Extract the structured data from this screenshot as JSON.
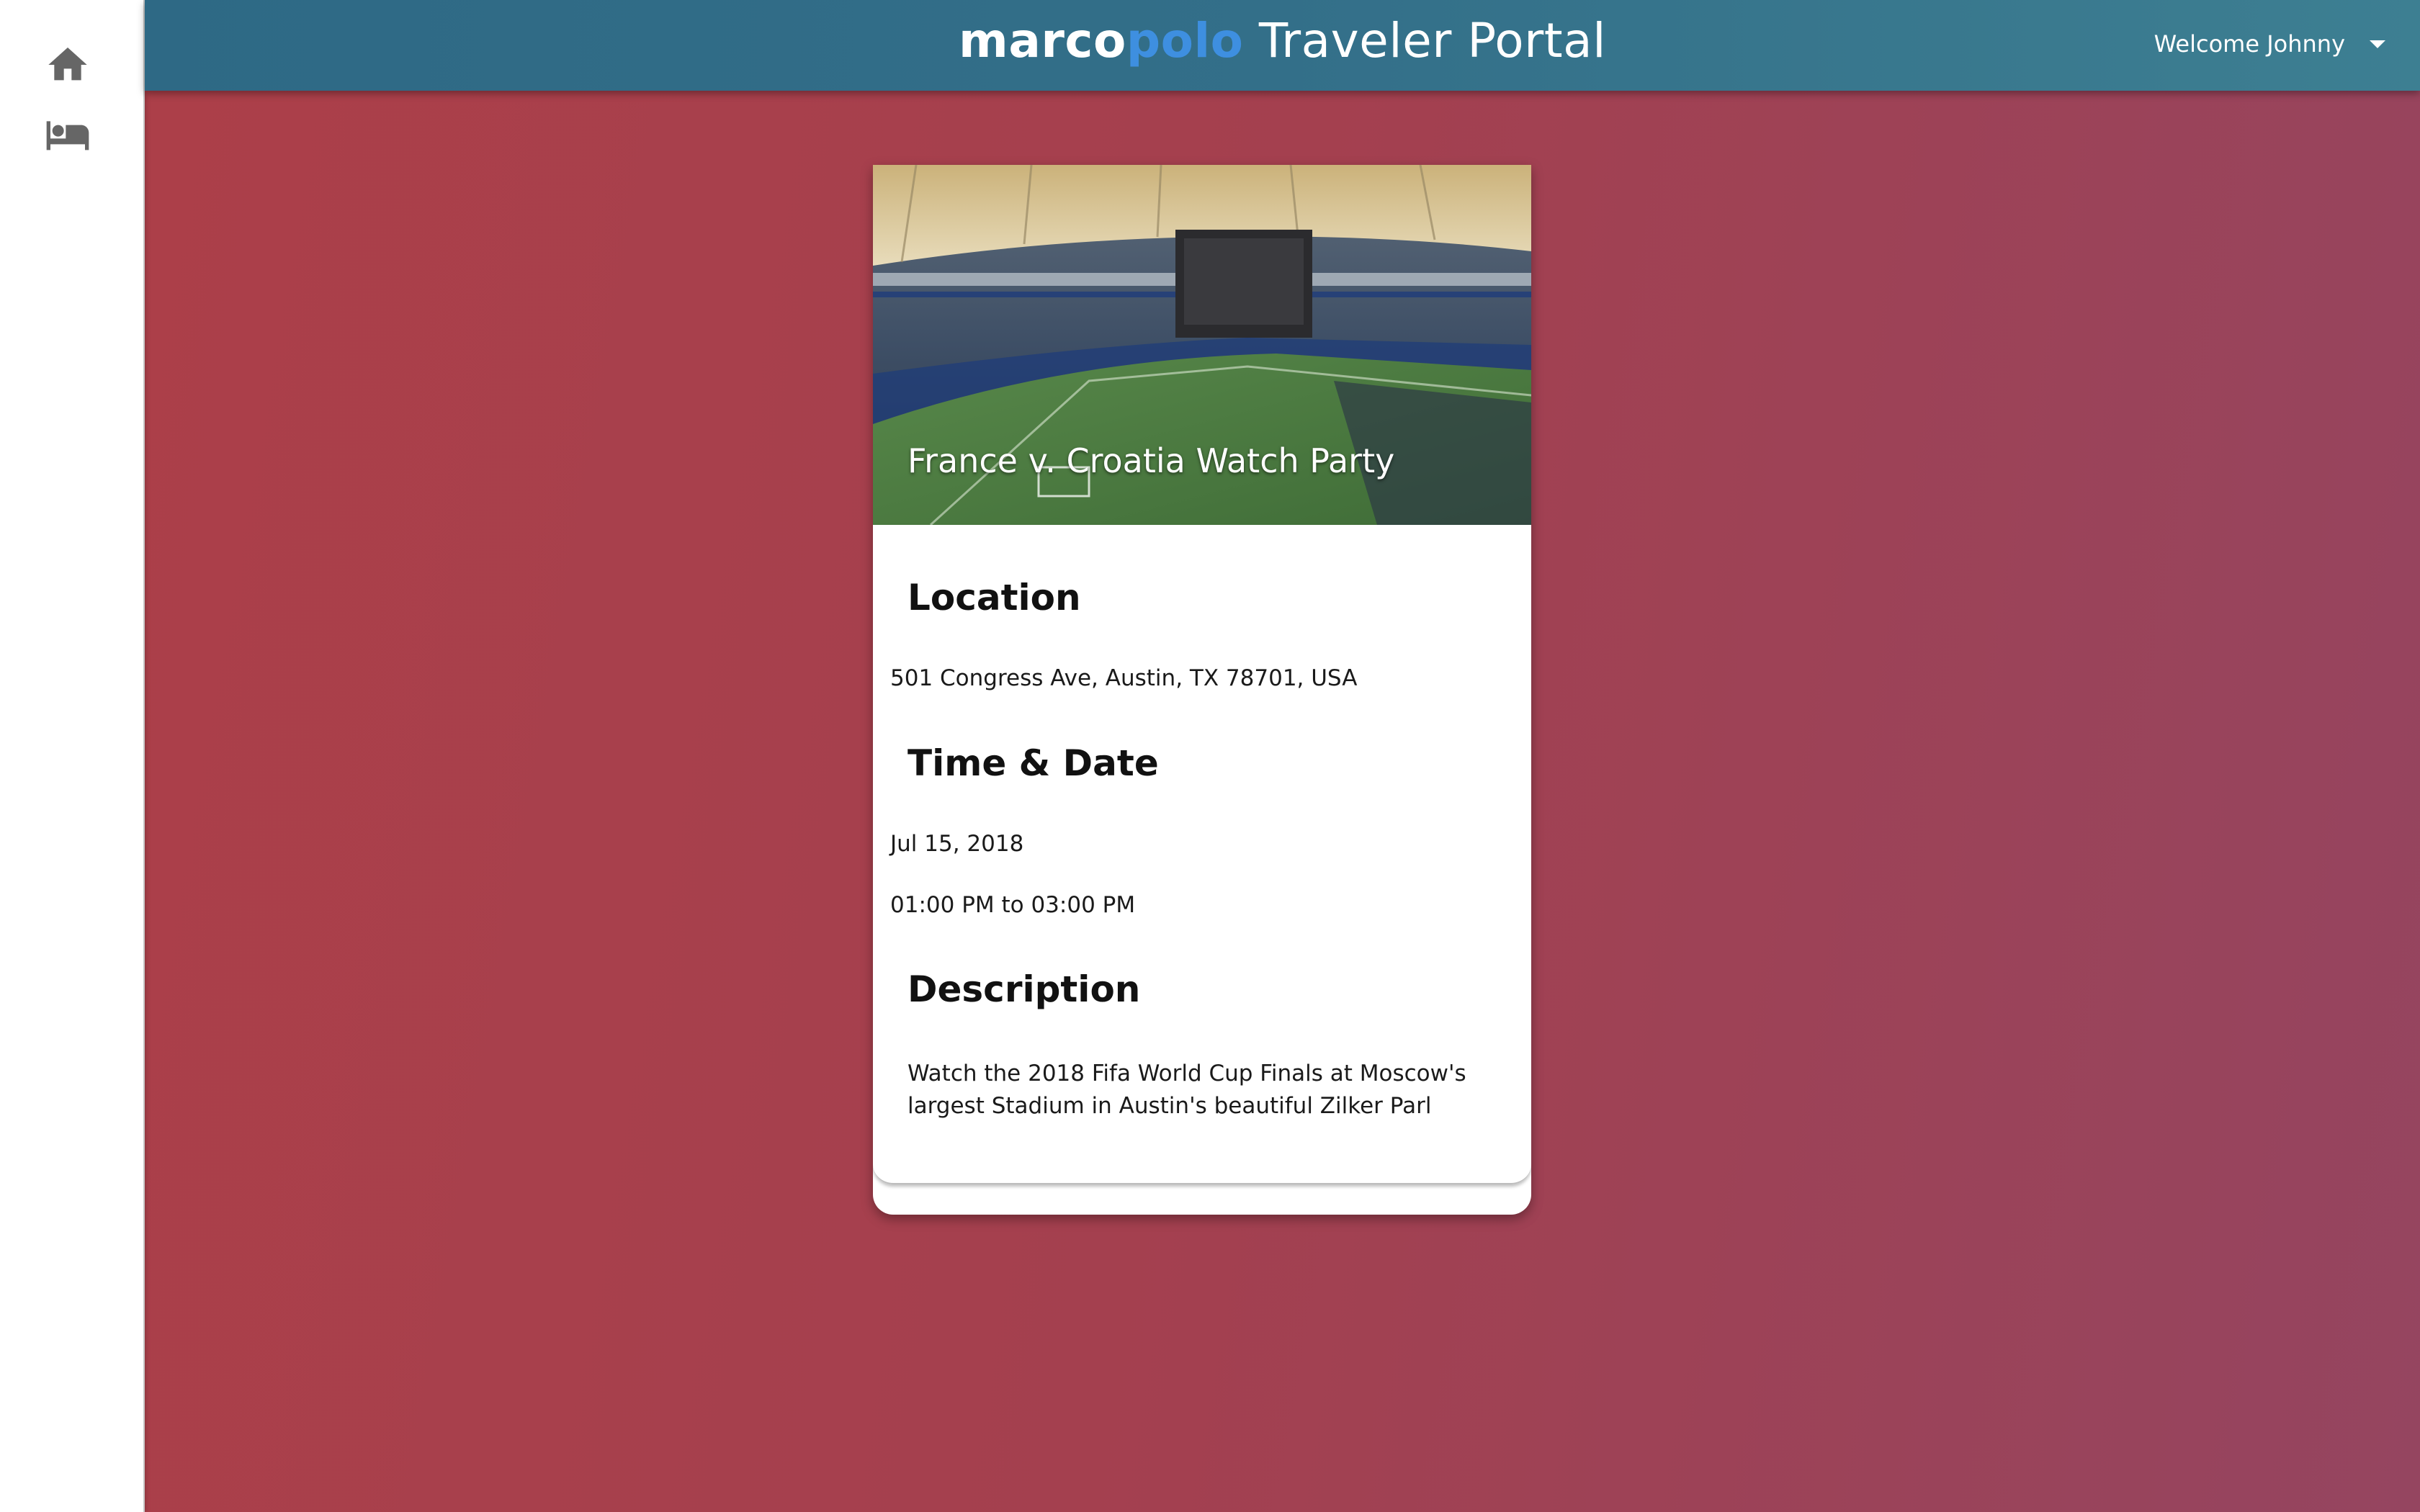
{
  "header": {
    "brand_part1": "marco",
    "brand_part2": "polo",
    "brand_part3": " Traveler Portal",
    "welcome": "Welcome Johnny"
  },
  "sidebar": {
    "items": [
      {
        "icon": "home-icon"
      },
      {
        "icon": "bed-icon"
      }
    ]
  },
  "event": {
    "title": "France v. Croatia Watch Party",
    "location_heading": "Location",
    "location": "501 Congress Ave, Austin, TX 78701, USA",
    "time_heading": "Time & Date",
    "date": "Jul 15, 2018",
    "time": "01:00 PM to 03:00 PM",
    "description_heading": "Description",
    "description": "Watch the 2018 Fifa World Cup Finals at Moscow's largest Stadium in Austin's beautiful Zilker Parl"
  },
  "colors": {
    "header_bg": "#2e6985",
    "brand_accent": "#3e8fe0",
    "page_bg": "#a4404f",
    "icon_gray": "#666666"
  }
}
